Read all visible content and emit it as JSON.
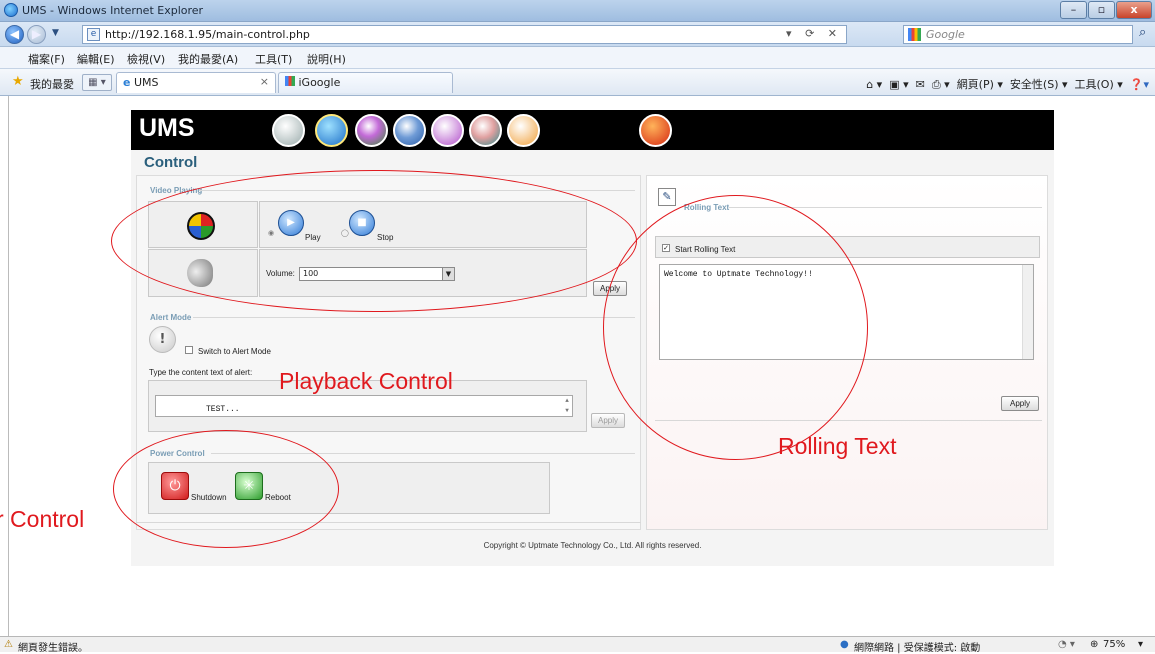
{
  "browser": {
    "title": "UMS - Windows Internet Explorer",
    "window_buttons": {
      "minimize": "–",
      "restore": "▫",
      "close": "x"
    },
    "url": "http://192.168.1.95/main-control.php",
    "search_placeholder": "Google",
    "menu": [
      "檔案(F)",
      "編輯(E)",
      "檢視(V)",
      "我的最愛(A)",
      "工具(T)",
      "說明(H)"
    ],
    "favorites_label": "我的最愛",
    "tabs": [
      {
        "label": "UMS",
        "active": true
      },
      {
        "label": "iGoogle",
        "active": false
      }
    ],
    "tab_close": "×",
    "command_bar": [
      "網頁(P) ▾",
      "安全性(S) ▾",
      "工具(O) ▾"
    ],
    "status_left": "網頁發生錯誤。",
    "status_zone": "網際網路 | 受保護模式: 啟動",
    "zoom": "75%"
  },
  "ums": {
    "logo": "UMS",
    "page_title": "Control",
    "video": {
      "legend": "Video Playing",
      "play_label": "Play",
      "stop_label": "Stop",
      "volume_label": "Volume:",
      "volume_value": "100",
      "apply_label": "Apply"
    },
    "alert": {
      "legend": "Alert Mode",
      "switch_label": "Switch to Alert Mode",
      "content_label": "Type the content text of alert:",
      "content_value": "TEST...",
      "apply_label": "Apply"
    },
    "power": {
      "legend": "Power Control",
      "shutdown_label": "Shutdown",
      "reboot_label": "Reboot"
    },
    "rolling": {
      "legend": "Rolling Text",
      "start_label": "Start Rolling Text",
      "text_value": "Welcome to Uptmate Technology!!",
      "apply_label": "Apply"
    },
    "copyright": "Copyright © Uptmate Technology Co., Ltd. All rights reserved."
  },
  "annotations": {
    "playback": "Playback Control",
    "rolling": "Rolling Text",
    "power": "r Control"
  },
  "colors": {
    "annotation": "#e0191e",
    "header_bg": "#000000",
    "title_color": "#2a5f7c"
  }
}
